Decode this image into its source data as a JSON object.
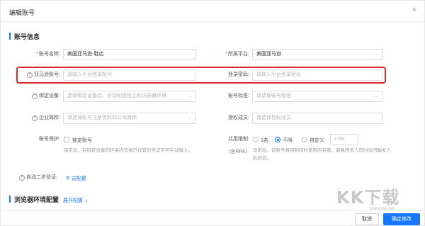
{
  "header": {
    "title": "编辑账号",
    "close_label": "×"
  },
  "section_account": {
    "title": "账号信息"
  },
  "fields": {
    "account_name": {
      "label": "账号名称:",
      "value": "美国亚马逊-鞋店"
    },
    "platform": {
      "label": "所属平台:",
      "value": "美国亚马逊"
    },
    "amazon_account": {
      "label": "亚马逊账号:",
      "placeholder": "请输入平台登录账号"
    },
    "login_password": {
      "label": "登录密码:",
      "placeholder": "请输入平台登录密码"
    },
    "bind_device": {
      "label": "绑定设备:",
      "placeholder": "选择绑定设备后，自动创建独立的浏览器环境"
    },
    "account_tags": {
      "label": "账号标签:",
      "placeholder": "请选择账号标签"
    },
    "company": {
      "label": "企业简称:",
      "placeholder": "请选择账号注册资料的公司简称"
    },
    "authorized_members": {
      "label": "授权成员:",
      "placeholder": "请选择授权成员"
    },
    "account_protection": {
      "label": "账号保护:",
      "checkbox_label": "锁定账号",
      "note": "锁定后，在绑定设备的环境内登录已托管的凭证不可手动输入。"
    },
    "shared_limit": {
      "label": "共用限制:",
      "sublabel": "(含RPA)",
      "options": [
        "1名",
        "不限",
        "自定义"
      ],
      "selected": "不限",
      "range_placeholder": "1-99",
      "note": "设定后，该账号将限制同时使用的名额，避免因多人同时访问触发人机校验。"
    },
    "two_step": {
      "label": "自动二步验证:",
      "link": "去配置"
    }
  },
  "section_browser": {
    "title": "浏览器环境配置",
    "link": "展开配置"
  },
  "footer": {
    "cancel_label": "取消",
    "confirm_label": "确定修改"
  },
  "watermark": {
    "big": "KK下载",
    "small": "www.kkx.net"
  },
  "colors": {
    "accent": "#1677ff",
    "highlight": "#e02a2a",
    "required": "#e0443b"
  }
}
